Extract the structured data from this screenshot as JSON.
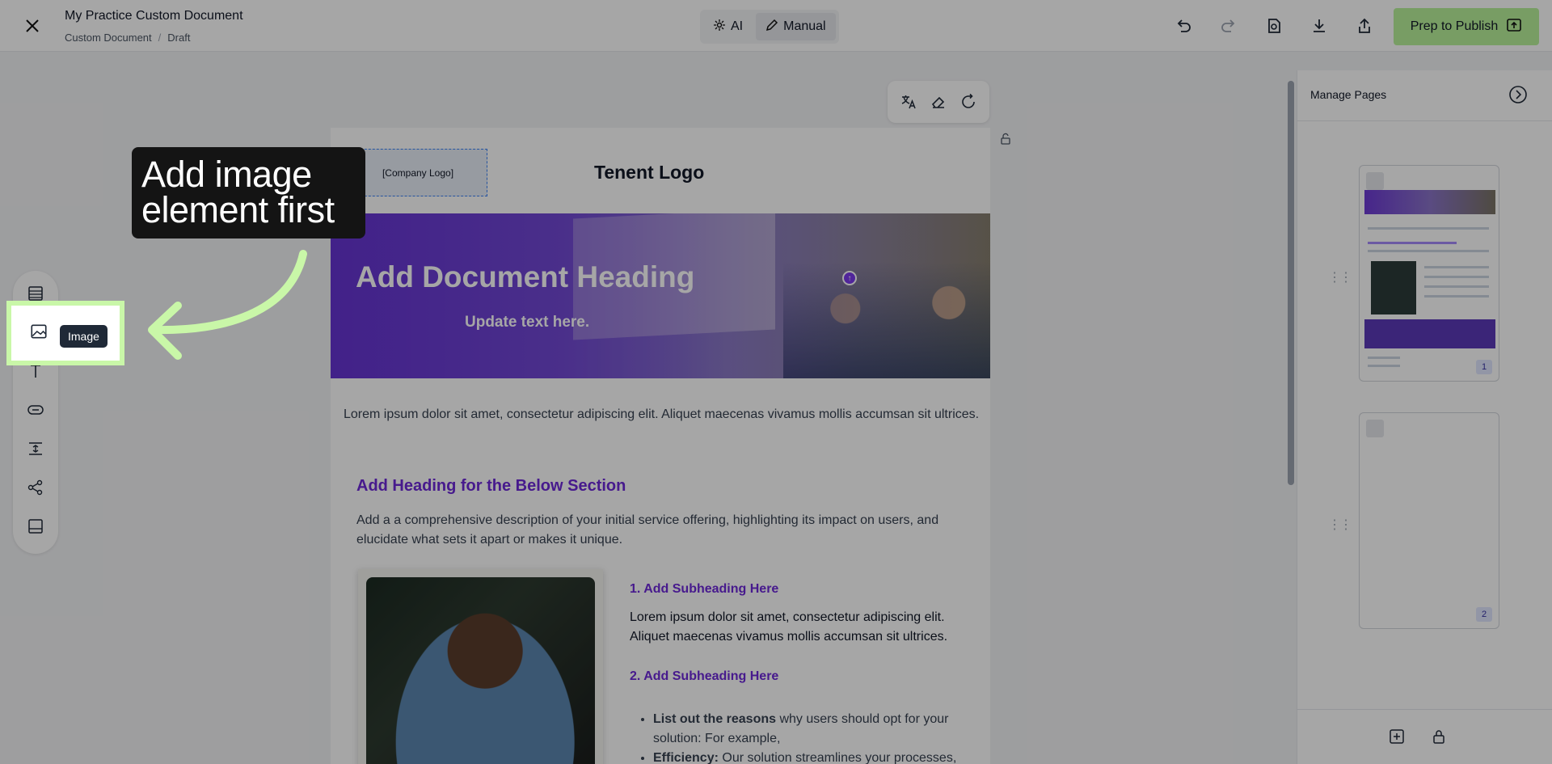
{
  "header": {
    "doc_title": "My Practice Custom Document",
    "breadcrumb": [
      "Custom Document",
      "Draft"
    ],
    "modes": [
      {
        "label": "AI",
        "active": false
      },
      {
        "label": "Manual",
        "active": true
      }
    ],
    "publish_label": "Prep to Publish",
    "icons": [
      "close-icon",
      "undo-icon",
      "redo-icon",
      "preview-icon",
      "download-icon",
      "share-icon",
      "publish-icon"
    ]
  },
  "canvas": {
    "company_logo": "[Company Logo]",
    "tenant_logo": "Tenent Logo",
    "hero_title": "Add Document Heading",
    "hero_subtitle": "Update text here.",
    "intro": "Lorem ipsum dolor sit amet, consectetur adipiscing elit. Aliquet maecenas vivamus mollis accumsan sit ultrices.",
    "section_heading": "Add Heading for the Below Section",
    "section_desc": "Add a a comprehensive description of your initial service offering, highlighting its impact on users, and elucidate what sets it apart or makes it unique.",
    "sub1": "1. Add Subheading Here",
    "sub1_text": "Lorem ipsum dolor sit amet, consectetur adipiscing elit. Aliquet maecenas vivamus mollis accumsan sit ultrices.",
    "sub2": "2. Add Subheading Here",
    "bullet1_bold": "List out the reasons",
    "bullet1_rest": " why users should opt for your solution: For example,",
    "bullet2_bold": "Efficiency:",
    "bullet2_rest": " Our solution streamlines your processes,"
  },
  "tools": {
    "items": [
      "table-icon",
      "image-icon",
      "text-icon",
      "button-icon",
      "spacer-icon",
      "social-icon",
      "footer-icon"
    ],
    "tooltip": "Image"
  },
  "callout": {
    "text": "Add image element first",
    "accent": "#c9f7a8"
  },
  "right_panel": {
    "title": "Manage Pages",
    "pages": [
      {
        "num": "1"
      },
      {
        "num": "2"
      }
    ]
  },
  "colors": {
    "publish": "#b8f29a",
    "heading_purple": "#6d28d9"
  }
}
